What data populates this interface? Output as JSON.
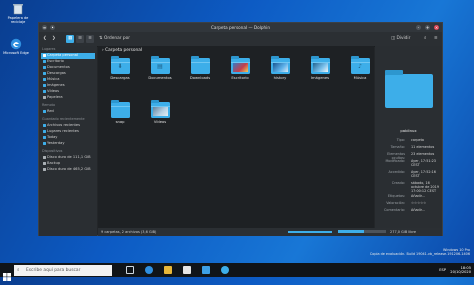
{
  "desktop": {
    "icons": [
      {
        "label": "Papelera de reciclaje",
        "icon": "recycle-bin-icon"
      },
      {
        "label": "Microsoft Edge",
        "icon": "edge-icon"
      }
    ],
    "watermark": [
      "Windows 10 Pro",
      "Copia de evaluación. Build 19041.vb_release.191206-1406"
    ]
  },
  "window": {
    "title": "Carpeta personal — Dolphin",
    "toolbar": {
      "sort_label": "Ordenar por",
      "split_label": "Dividir"
    },
    "breadcrumb": "Carpeta personal",
    "sidebar": {
      "sections": [
        {
          "title": "Lugares",
          "items": [
            "Carpeta personal",
            "Escritorio",
            "Documentos",
            "Descargas",
            "Música",
            "Imágenes",
            "Vídeos",
            "Papelera"
          ]
        },
        {
          "title": "Remoto",
          "items": [
            "Red"
          ]
        },
        {
          "title": "Guardado recientemente",
          "items": [
            "Archivos recientes",
            "Lugares recientes",
            "Today",
            "Yesterday"
          ]
        },
        {
          "title": "Dispositivos",
          "items": [
            "Disco duro de 111,1 GiB",
            "Backup",
            "Disco duro de 465,2 GiB"
          ]
        }
      ]
    },
    "files": [
      {
        "name": "Descargas",
        "type": "folder",
        "glyph": "⬇"
      },
      {
        "name": "Documentos",
        "type": "folder",
        "glyph": "▤"
      },
      {
        "name": "Downloads",
        "type": "folder",
        "glyph": ""
      },
      {
        "name": "Escritorio",
        "type": "folder-image",
        "glyph": ""
      },
      {
        "name": "history",
        "type": "folder-image",
        "glyph": ""
      },
      {
        "name": "Imágenes",
        "type": "folder-image",
        "glyph": ""
      },
      {
        "name": "Música",
        "type": "folder",
        "glyph": "♪"
      },
      {
        "name": "snap",
        "type": "folder",
        "glyph": ""
      },
      {
        "name": "Vídeos",
        "type": "folder-image",
        "glyph": ""
      }
    ],
    "status": {
      "left": "9 carpetas, 2 archivos (3,6 GiB)",
      "right": "277,0 GiB libre"
    },
    "info_panel": {
      "name": "pablinux",
      "rows": [
        {
          "k": "Tipo:",
          "v": "carpeta"
        },
        {
          "k": "Tamaño:",
          "v": "11 elementos"
        },
        {
          "k": "Elementos ocultos:",
          "v": "23 elementos"
        },
        {
          "k": "Modificado:",
          "v": "Ayer, 17:51:23 CEST"
        },
        {
          "k": "Accedido:",
          "v": "Ayer, 17:52:16 CEST"
        },
        {
          "k": "Creado:",
          "v": "sábado, 16 octubre de 2019 17:00:12 CEST"
        },
        {
          "k": "Etiquetas:",
          "v": "Añadir..."
        },
        {
          "k": "Valoración:",
          "v": "☆☆☆☆☆"
        },
        {
          "k": "Comentario:",
          "v": "Añadir..."
        }
      ]
    }
  },
  "taskbar": {
    "search_placeholder": "Escribe aquí para buscar",
    "time": "18:05",
    "date": "20/10/2020",
    "lang": "ESP"
  },
  "colors": {
    "accent": "#3daee9",
    "window_bg": "#232629",
    "taskbar": "#101418"
  }
}
